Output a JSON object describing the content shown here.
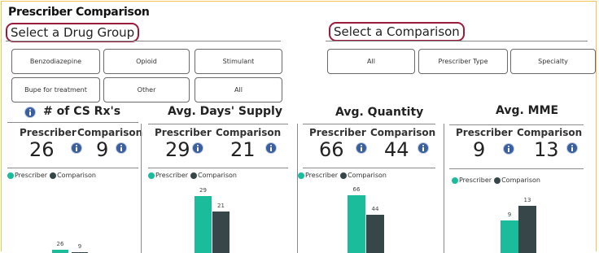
{
  "header": {
    "title": "Prescriber Comparison",
    "drug_group_heading": "Select a Drug Group",
    "comparison_heading": "Select a Comparison"
  },
  "drug_group_buttons": [
    "Benzodiazepine",
    "Opioid",
    "Stimulant",
    "Bupe for treatment",
    "Other",
    "All"
  ],
  "comparison_buttons": [
    "All",
    "Prescriber Type",
    "Specialty"
  ],
  "labels": {
    "prescriber": "Prescriber",
    "comparison": "Comparison"
  },
  "legend": {
    "prescriber": "Prescriber",
    "comparison": "Comparison"
  },
  "colors": {
    "prescriber": "#1abc9c",
    "comparison": "#374649",
    "highlight_border": "#9a1c3c",
    "frame_border": "#f3c35a"
  },
  "metrics": [
    {
      "title": "# of CS Rx's",
      "prescriber": "26",
      "comparison": "9"
    },
    {
      "title": "Avg. Days' Supply",
      "prescriber": "29",
      "comparison": "21"
    },
    {
      "title": "Avg. Quantity",
      "prescriber": "66",
      "comparison": "44"
    },
    {
      "title": "Avg. MME",
      "prescriber": "9",
      "comparison": "13"
    }
  ],
  "chart_data": [
    {
      "type": "bar",
      "categories": [
        ""
      ],
      "series": [
        {
          "name": "Prescriber",
          "values": [
            26
          ]
        },
        {
          "name": "Comparison",
          "values": [
            9
          ]
        }
      ]
    },
    {
      "type": "bar",
      "categories": [
        ""
      ],
      "series": [
        {
          "name": "Prescriber",
          "values": [
            29
          ]
        },
        {
          "name": "Comparison",
          "values": [
            21
          ]
        }
      ]
    },
    {
      "type": "bar",
      "categories": [
        ""
      ],
      "series": [
        {
          "name": "Prescriber",
          "values": [
            66
          ]
        },
        {
          "name": "Comparison",
          "values": [
            44
          ]
        }
      ]
    },
    {
      "type": "bar",
      "categories": [
        ""
      ],
      "series": [
        {
          "name": "Prescriber",
          "values": [
            9
          ]
        },
        {
          "name": "Comparison",
          "values": [
            13
          ]
        }
      ]
    }
  ]
}
